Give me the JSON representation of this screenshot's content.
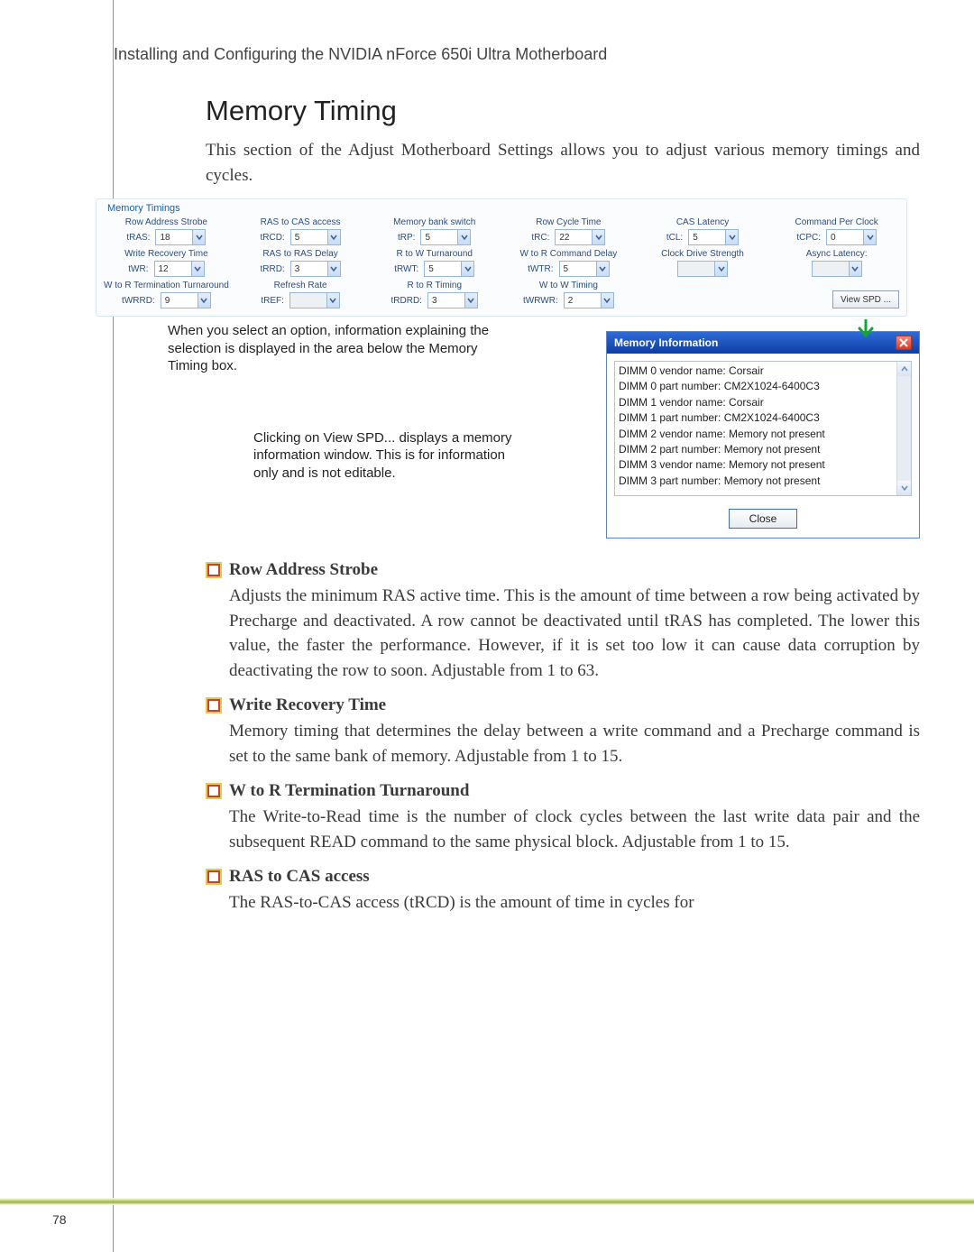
{
  "breadcrumb": "Installing and Configuring the NVIDIA nForce 650i Ultra Motherboard",
  "section": {
    "title": "Memory Timing",
    "intro": "This section of the Adjust Motherboard Settings allows you to adjust various memory timings and cycles."
  },
  "panel": {
    "title": "Memory Timings",
    "view_spd_label": "View SPD ...",
    "fields": [
      {
        "caption": "Row Address Strobe",
        "label": "tRAS:",
        "value": "18",
        "enabled": true
      },
      {
        "caption": "RAS to CAS access",
        "label": "tRCD:",
        "value": "5",
        "enabled": true
      },
      {
        "caption": "Memory bank switch",
        "label": "tRP:",
        "value": "5",
        "enabled": true
      },
      {
        "caption": "Row Cycle Time",
        "label": "tRC:",
        "value": "22",
        "enabled": true
      },
      {
        "caption": "CAS Latency",
        "label": "tCL:",
        "value": "5",
        "enabled": true
      },
      {
        "caption": "Command Per Clock",
        "label": "tCPC:",
        "value": "0",
        "enabled": true
      },
      {
        "caption": "Write Recovery Time",
        "label": "tWR:",
        "value": "12",
        "enabled": true
      },
      {
        "caption": "RAS to RAS Delay",
        "label": "tRRD:",
        "value": "3",
        "enabled": true
      },
      {
        "caption": "R to W Turnaround",
        "label": "tRWT:",
        "value": "5",
        "enabled": true
      },
      {
        "caption": "W to R Command Delay",
        "label": "tWTR:",
        "value": "5",
        "enabled": true
      },
      {
        "caption": "Clock Drive Strength",
        "label": "",
        "value": "",
        "enabled": false
      },
      {
        "caption": "Async Latency:",
        "label": "",
        "value": "",
        "enabled": false
      },
      {
        "caption": "W to R Termination Turnaround",
        "label": "tWRRD:",
        "value": "9",
        "enabled": true
      },
      {
        "caption": "Refresh Rate",
        "label": "tREF:",
        "value": "",
        "enabled": false
      },
      {
        "caption": "R to R Timing",
        "label": "tRDRD:",
        "value": "3",
        "enabled": true
      },
      {
        "caption": "W to W Timing",
        "label": "tWRWR:",
        "value": "2",
        "enabled": true
      }
    ]
  },
  "notes": {
    "n1": "When you select an option, information explaining the selection is displayed in the area below the Memory Timing box.",
    "n2": "Clicking on View SPD... displays a memory information window. This is for information only and is not editable."
  },
  "mi": {
    "title": "Memory Information",
    "close_label": "Close",
    "lines": [
      "DIMM 0 vendor name: Corsair",
      "DIMM 0 part number: CM2X1024-6400C3",
      "DIMM 1 vendor name: Corsair",
      "DIMM 1 part number: CM2X1024-6400C3",
      "DIMM 2 vendor name: Memory not present",
      "DIMM 2 part number: Memory not present",
      "DIMM 3 vendor name: Memory not present",
      "DIMM 3 part number: Memory not present"
    ]
  },
  "items": [
    {
      "title": "Row Address Strobe",
      "body": "Adjusts the minimum RAS active time. This is the amount of time between a row being activated by Precharge and deactivated. A row cannot be deactivated until tRAS has completed. The lower this value, the faster the performance. However, if it is set too low it can cause data corruption by deactivating the row to soon. Adjustable from 1 to 63."
    },
    {
      "title": "Write Recovery Time",
      "body": "Memory timing that determines the delay between a write command and a Precharge command is set to the same bank of memory. Adjustable from 1 to 15."
    },
    {
      "title": "W to R Termination Turnaround",
      "body": "The Write-to-Read time is the number of clock cycles between the last write data pair and the subsequent READ command to the same physical block. Adjustable from 1 to 15."
    },
    {
      "title": "RAS to CAS access",
      "body": "The RAS-to-CAS access (tRCD) is the amount of time in cycles for"
    }
  ],
  "page_number": "78"
}
